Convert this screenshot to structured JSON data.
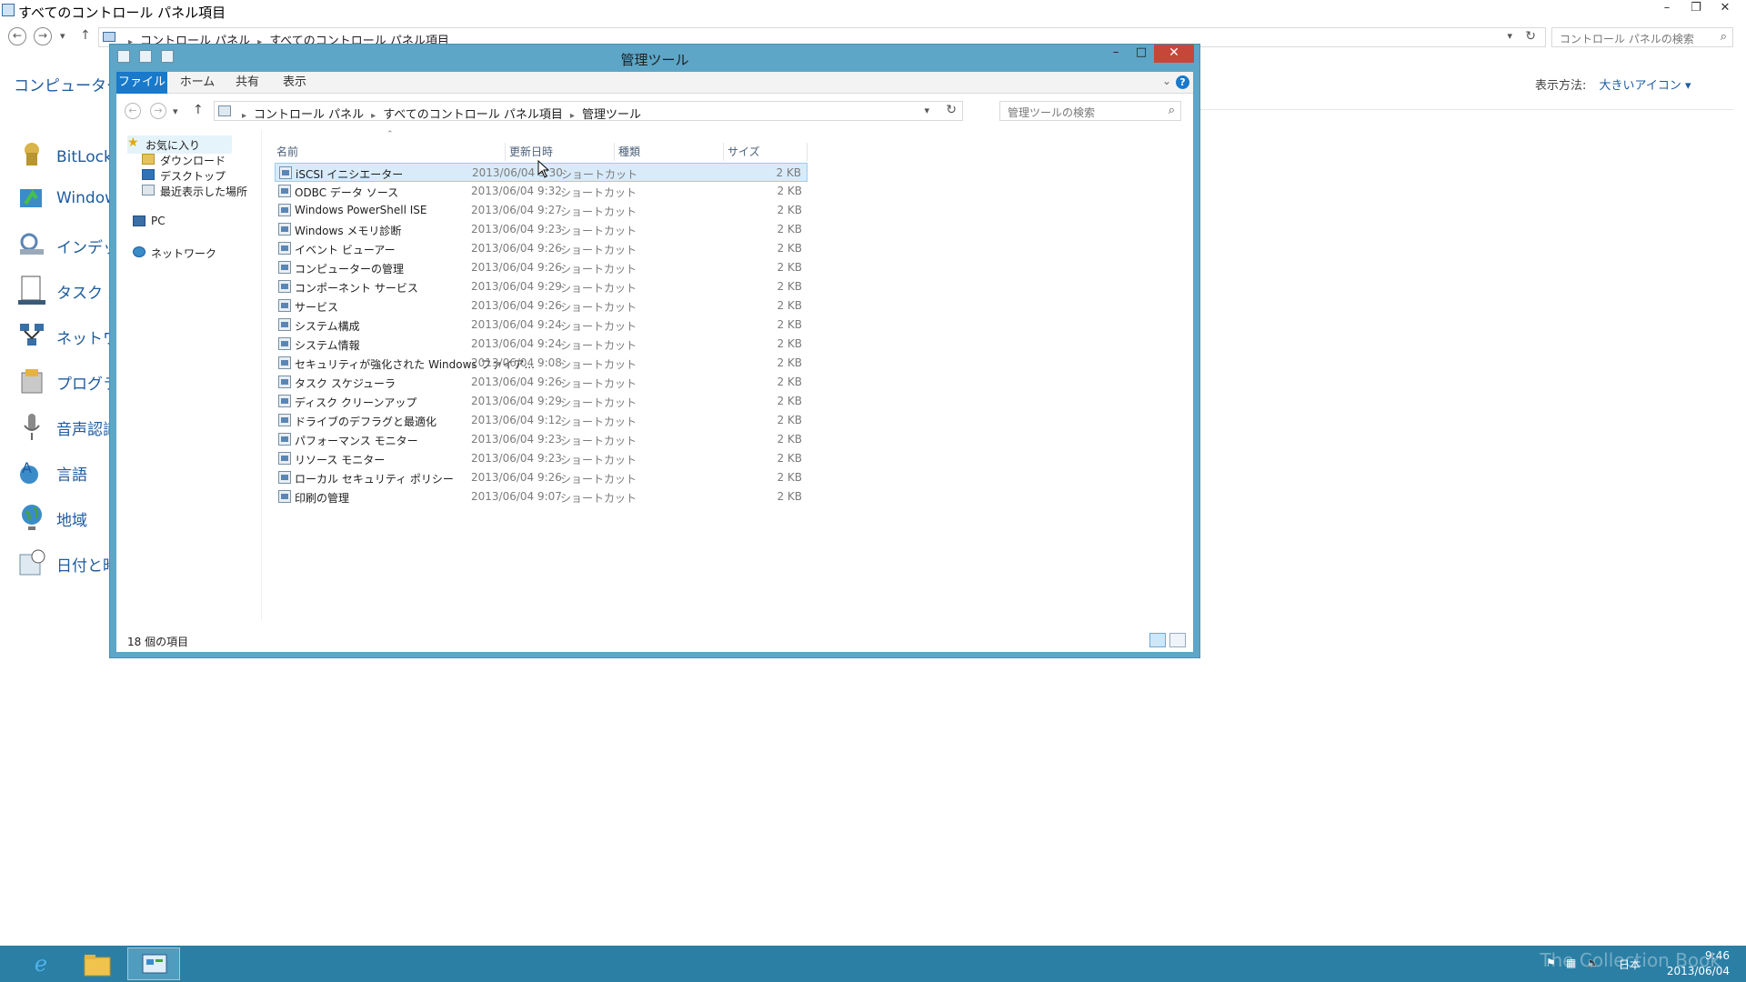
{
  "bg_window": {
    "title": "すべてのコントロール パネル項目",
    "breadcrumbs": [
      "コントロール パネル",
      "すべてのコントロール パネル項目"
    ],
    "search_placeholder": "コントロール パネルの検索",
    "heading": "コンピューターの設定を調整します",
    "view_label": "表示方法:",
    "view_value": "大きいアイコン ▾",
    "items": [
      {
        "label": "BitLocker ドライブ暗号化",
        "icon": "bitlocker-icon"
      },
      {
        "label": "Windows Update",
        "icon": "windows-update-icon"
      },
      {
        "label": "インデックスのオプション",
        "icon": "indexing-options-icon"
      },
      {
        "label": "タスク バー",
        "icon": "taskbar-icon"
      },
      {
        "label": "ネットワークと共有センター",
        "icon": "network-icon"
      },
      {
        "label": "プログラムと機能",
        "icon": "programs-icon"
      },
      {
        "label": "音声認識",
        "icon": "microphone-icon"
      },
      {
        "label": "言語",
        "icon": "language-icon"
      },
      {
        "label": "地域",
        "icon": "region-globe-icon"
      },
      {
        "label": "日付と時刻",
        "icon": "date-time-icon"
      }
    ]
  },
  "explorer": {
    "title": "管理ツール",
    "ribbon_tabs": [
      "ファイル",
      "ホーム",
      "共有",
      "表示"
    ],
    "breadcrumbs": [
      "コントロール パネル",
      "すべてのコントロール パネル項目",
      "管理ツール"
    ],
    "search_placeholder": "管理ツールの検索",
    "nav": {
      "favorites": "お気に入り",
      "downloads": "ダウンロード",
      "desktop": "デスクトップ",
      "recent": "最近表示した場所",
      "pc": "PC",
      "network": "ネットワーク"
    },
    "columns": {
      "name": "名前",
      "date": "更新日時",
      "type": "種類",
      "size": "サイズ"
    },
    "files": [
      {
        "name": "iSCSI イニシエーター",
        "date": "2013/06/04 9:30",
        "type": "ショートカット",
        "size": "2 KB"
      },
      {
        "name": "ODBC データ ソース",
        "date": "2013/06/04 9:32",
        "type": "ショートカット",
        "size": "2 KB"
      },
      {
        "name": "Windows PowerShell ISE",
        "date": "2013/06/04 9:27",
        "type": "ショートカット",
        "size": "2 KB"
      },
      {
        "name": "Windows メモリ診断",
        "date": "2013/06/04 9:23",
        "type": "ショートカット",
        "size": "2 KB"
      },
      {
        "name": "イベント ビューアー",
        "date": "2013/06/04 9:26",
        "type": "ショートカット",
        "size": "2 KB"
      },
      {
        "name": "コンピューターの管理",
        "date": "2013/06/04 9:26",
        "type": "ショートカット",
        "size": "2 KB"
      },
      {
        "name": "コンポーネント サービス",
        "date": "2013/06/04 9:29",
        "type": "ショートカット",
        "size": "2 KB"
      },
      {
        "name": "サービス",
        "date": "2013/06/04 9:26",
        "type": "ショートカット",
        "size": "2 KB"
      },
      {
        "name": "システム構成",
        "date": "2013/06/04 9:24",
        "type": "ショートカット",
        "size": "2 KB"
      },
      {
        "name": "システム情報",
        "date": "2013/06/04 9:24",
        "type": "ショートカット",
        "size": "2 KB"
      },
      {
        "name": "セキュリティが強化された Windows ファイア...",
        "date": "2013/06/04 9:08",
        "type": "ショートカット",
        "size": "2 KB"
      },
      {
        "name": "タスク スケジューラ",
        "date": "2013/06/04 9:26",
        "type": "ショートカット",
        "size": "2 KB"
      },
      {
        "name": "ディスク クリーンアップ",
        "date": "2013/06/04 9:29",
        "type": "ショートカット",
        "size": "2 KB"
      },
      {
        "name": "ドライブのデフラグと最適化",
        "date": "2013/06/04 9:12",
        "type": "ショートカット",
        "size": "2 KB"
      },
      {
        "name": "パフォーマンス モニター",
        "date": "2013/06/04 9:23",
        "type": "ショートカット",
        "size": "2 KB"
      },
      {
        "name": "リソース モニター",
        "date": "2013/06/04 9:23",
        "type": "ショートカット",
        "size": "2 KB"
      },
      {
        "name": "ローカル セキュリティ ポリシー",
        "date": "2013/06/04 9:26",
        "type": "ショートカット",
        "size": "2 KB"
      },
      {
        "name": "印刷の管理",
        "date": "2013/06/04 9:07",
        "type": "ショートカット",
        "size": "2 KB"
      }
    ],
    "status": "18 個の項目"
  },
  "taskbar": {
    "apps": [
      "internet-explorer-icon",
      "file-explorer-icon",
      "control-panel-icon"
    ],
    "language": "日本",
    "time": "9:46",
    "date": "2013/06/04",
    "watermark": "The Collection Book"
  },
  "colors": {
    "accent": "#1979ca",
    "titlebar": "#5da6c7",
    "taskbar": "#2b7fa5",
    "close": "#c7463a",
    "link": "#1e5b9f"
  }
}
